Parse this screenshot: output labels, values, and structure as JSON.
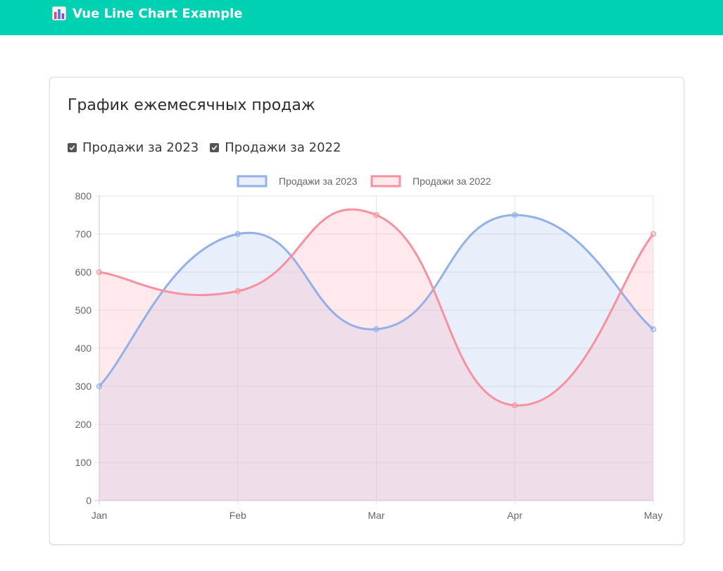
{
  "header": {
    "title": "Vue Line Chart Example",
    "logo_icon": "bar-chart-icon",
    "color": "#00d1b2"
  },
  "card": {
    "title": "График ежемесячных продаж"
  },
  "toggles": [
    {
      "label": "Продажи за 2023",
      "checked": true
    },
    {
      "label": "Продажи за 2022",
      "checked": true
    }
  ],
  "chart_data": {
    "type": "line",
    "categories": [
      "Jan",
      "Feb",
      "Mar",
      "Apr",
      "May"
    ],
    "series": [
      {
        "name": "Продажи за 2023",
        "values": [
          300,
          700,
          450,
          750,
          450
        ],
        "color": "#93b0e8",
        "fill": "rgba(147,176,232,0.2)"
      },
      {
        "name": "Продажи за 2022",
        "values": [
          600,
          550,
          750,
          250,
          700
        ],
        "color": "#f7919f",
        "fill": "rgba(255,182,197,0.3)"
      }
    ],
    "title": "",
    "xlabel": "",
    "ylabel": "",
    "ylim": [
      0,
      800
    ],
    "yticks": [
      0,
      100,
      200,
      300,
      400,
      500,
      600,
      700,
      800
    ],
    "grid": true,
    "legend": "top",
    "smooth": true,
    "filled": true
  }
}
